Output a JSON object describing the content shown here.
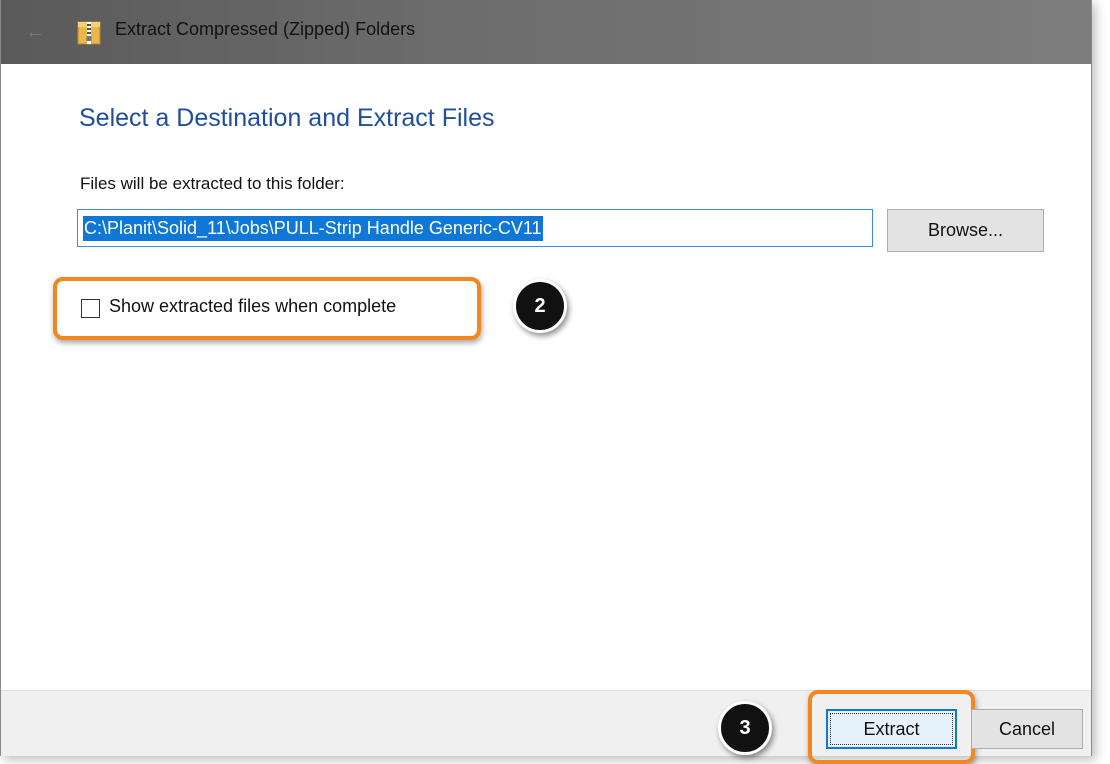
{
  "window": {
    "title": "Extract Compressed (Zipped) Folders",
    "icon": "zip-folder-icon"
  },
  "main": {
    "heading": "Select a Destination and Extract Files",
    "destination_label": "Files will be extracted to this folder:",
    "destination_path": "C:\\Planit\\Solid_11\\Jobs\\PULL-Strip Handle Generic-CV11",
    "browse_label": "Browse...",
    "show_files_label": "Show extracted files when complete",
    "show_files_checked": false
  },
  "annotations": {
    "step2": "2",
    "step3": "3",
    "highlight_color": "#f2861f"
  },
  "footer": {
    "extract_label": "Extract",
    "cancel_label": "Cancel"
  },
  "colors": {
    "heading": "#1f4e9c",
    "selection": "#0f78d7",
    "focus_border": "#3c8be0"
  }
}
